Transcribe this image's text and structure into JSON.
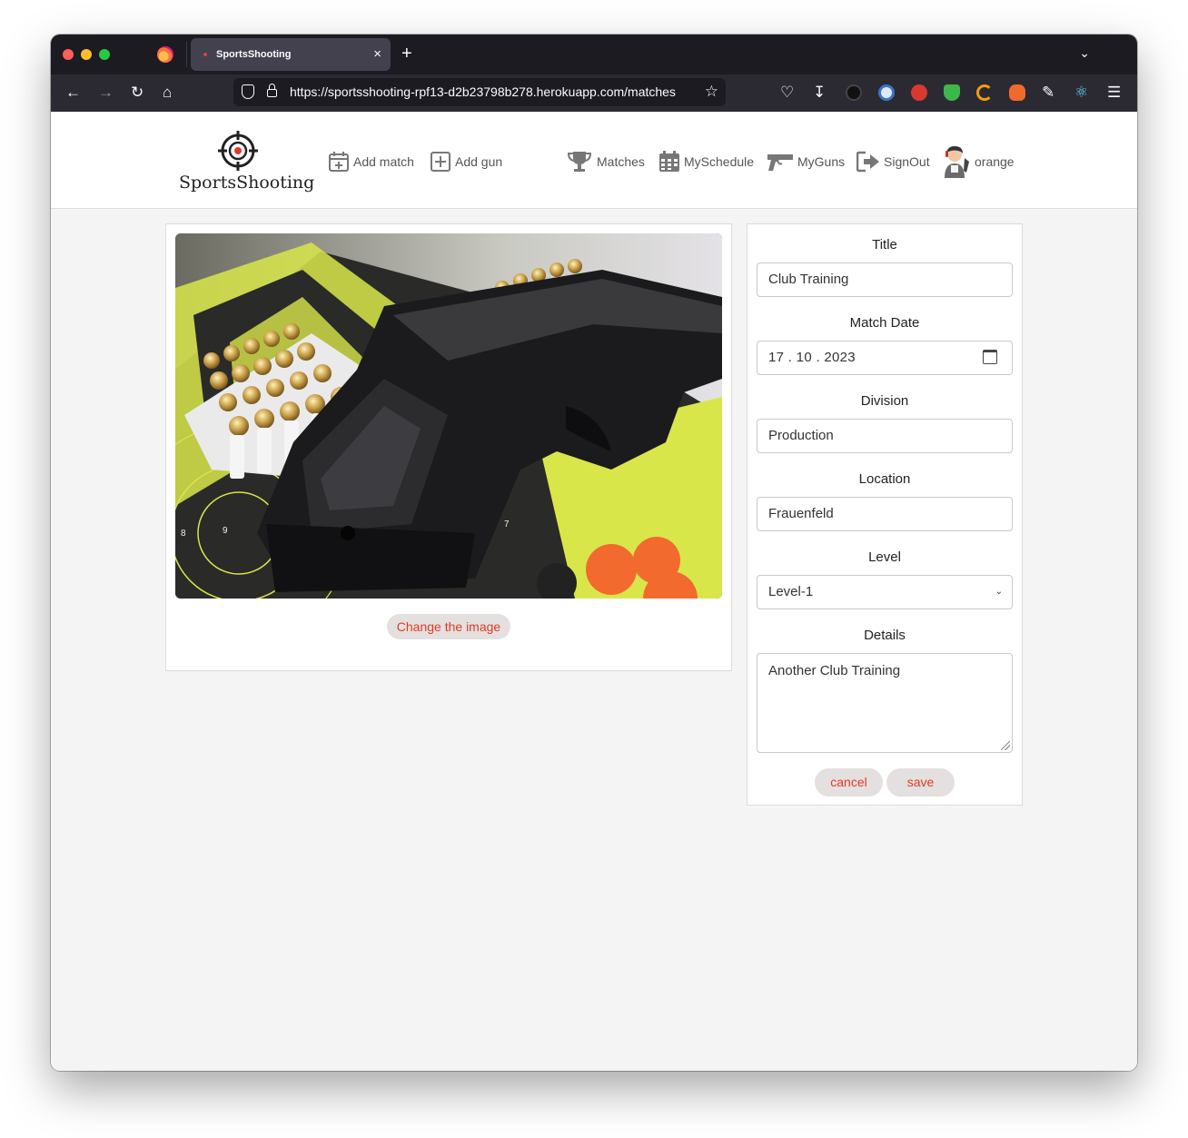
{
  "browser": {
    "tab_title": "SportsShooting",
    "tab_close": "×",
    "new_tab": "+",
    "url": "https://sportsshooting-rpf13-d2b23798b278.herokuapp.com/matches"
  },
  "site": {
    "brand": "SportsShooting",
    "nav": {
      "add_match": "Add match",
      "add_gun": "Add gun",
      "matches": "Matches",
      "my_schedule": "MySchedule",
      "my_guns": "MyGuns",
      "sign_out": "SignOut",
      "user": "orange"
    }
  },
  "image_card": {
    "change_button": "Change the image"
  },
  "form": {
    "title_label": "Title",
    "title_value": "Club Training",
    "date_label": "Match Date",
    "date_value": "17 . 10 . 2023",
    "division_label": "Division",
    "division_value": "Production",
    "location_label": "Location",
    "location_value": "Frauenfeld",
    "level_label": "Level",
    "level_value": "Level-1",
    "details_label": "Details",
    "details_value": "Another Club Training",
    "cancel_label": "cancel",
    "save_label": "save"
  },
  "colors": {
    "accent": "#e23a25",
    "pill_bg": "#e4e0df",
    "page_bg": "#f4f4f4"
  }
}
